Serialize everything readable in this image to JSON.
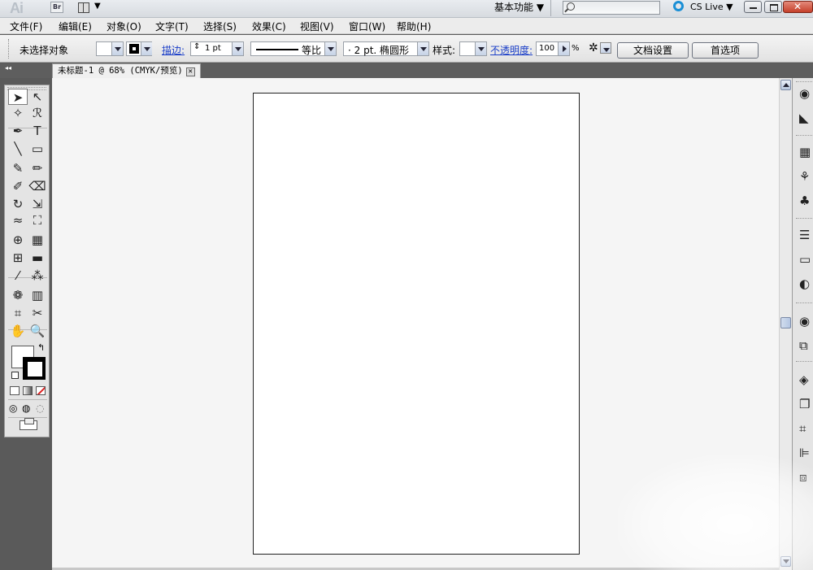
{
  "app": {
    "logo": "Ai",
    "bridge_badge": "Br"
  },
  "titlebar": {
    "workspace": "基本功能 ▼",
    "cs_live": "CS Live ▼"
  },
  "menu": [
    "文件(F)",
    "编辑(E)",
    "对象(O)",
    "文字(T)",
    "选择(S)",
    "效果(C)",
    "视图(V)",
    "窗口(W)",
    "帮助(H)"
  ],
  "control": {
    "selection_status": "未选择对象",
    "stroke_label": "描边:",
    "stroke_weight": "1 pt",
    "stroke_profile": "等比",
    "brush": "· 2 pt. 椭圆形",
    "style_label": "样式:",
    "opacity_label": "不透明度:",
    "opacity_value": "100",
    "opacity_unit": "%",
    "doc_setup_button": "文档设置",
    "preferences_button": "首选项"
  },
  "document": {
    "tab_title": "未标题-1 @ 68% (CMYK/预览)",
    "tab_close": "✕"
  },
  "tools": [
    {
      "name": "selection-tool-icon",
      "glyph": "➤"
    },
    {
      "name": "direct-selection-tool-icon",
      "glyph": "↖"
    },
    {
      "name": "magic-wand-tool-icon",
      "glyph": "✧"
    },
    {
      "name": "lasso-tool-icon",
      "glyph": "ℛ"
    },
    {
      "name": "pen-tool-icon",
      "glyph": "✒"
    },
    {
      "name": "type-tool-icon",
      "glyph": "T"
    },
    {
      "name": "line-tool-icon",
      "glyph": "╲"
    },
    {
      "name": "rectangle-tool-icon",
      "glyph": "▭"
    },
    {
      "name": "paintbrush-tool-icon",
      "glyph": "✎"
    },
    {
      "name": "pencil-tool-icon",
      "glyph": "✏"
    },
    {
      "name": "blob-brush-tool-icon",
      "glyph": "✐"
    },
    {
      "name": "eraser-tool-icon",
      "glyph": "⌫"
    },
    {
      "name": "rotate-tool-icon",
      "glyph": "↻"
    },
    {
      "name": "scale-tool-icon",
      "glyph": "⇲"
    },
    {
      "name": "warp-tool-icon",
      "glyph": "≈"
    },
    {
      "name": "free-transform-tool-icon",
      "glyph": "⛶"
    },
    {
      "name": "shape-builder-tool-icon",
      "glyph": "⊕"
    },
    {
      "name": "perspective-grid-tool-icon",
      "glyph": "▦"
    },
    {
      "name": "mesh-tool-icon",
      "glyph": "⊞"
    },
    {
      "name": "gradient-tool-icon",
      "glyph": "▬"
    },
    {
      "name": "eyedropper-tool-icon",
      "glyph": "⁄"
    },
    {
      "name": "blend-tool-icon",
      "glyph": "⁂"
    },
    {
      "name": "symbol-sprayer-tool-icon",
      "glyph": "❁"
    },
    {
      "name": "column-graph-tool-icon",
      "glyph": "▥"
    },
    {
      "name": "artboard-tool-icon",
      "glyph": "⌗"
    },
    {
      "name": "slice-tool-icon",
      "glyph": "✂"
    },
    {
      "name": "hand-tool-icon",
      "glyph": "✋"
    },
    {
      "name": "zoom-tool-icon",
      "glyph": "🔍"
    }
  ],
  "dock_icons": [
    {
      "name": "color-icon",
      "glyph": "◉"
    },
    {
      "name": "color-guide-icon",
      "glyph": "◣"
    },
    {
      "name": "swatches-icon",
      "glyph": "▦"
    },
    {
      "name": "brushes-icon",
      "glyph": "⚘"
    },
    {
      "name": "symbols-icon",
      "glyph": "♣"
    },
    {
      "name": "stroke-icon",
      "glyph": "☰"
    },
    {
      "name": "gradient-icon",
      "glyph": "▭"
    },
    {
      "name": "transparency-icon",
      "glyph": "◐"
    },
    {
      "name": "appearance-icon",
      "glyph": "◉"
    },
    {
      "name": "graphic-styles-icon",
      "glyph": "⧉"
    },
    {
      "name": "layers-icon",
      "glyph": "◈"
    },
    {
      "name": "artboards-icon",
      "glyph": "❐"
    },
    {
      "name": "transform-icon",
      "glyph": "⌗"
    },
    {
      "name": "align-icon",
      "glyph": "⊫"
    },
    {
      "name": "pathfinder-icon",
      "glyph": "⧈"
    }
  ]
}
